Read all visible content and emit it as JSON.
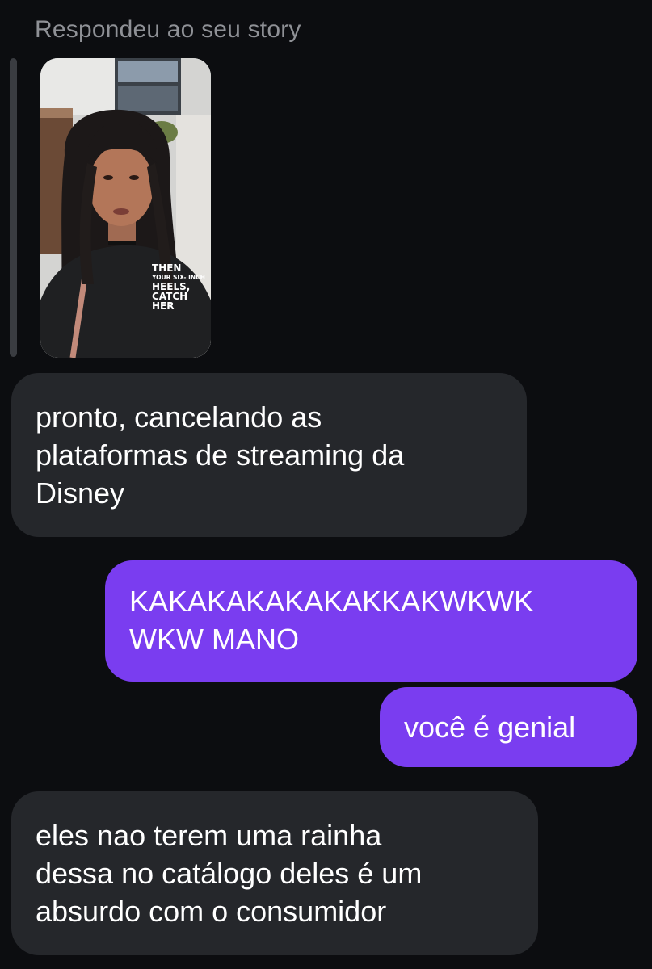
{
  "reply_label": "Respondeu ao seu story",
  "story": {
    "caption_line1": "THEN",
    "caption_line2": "YOUR SIX- INCH",
    "caption_line3": "HEELS,",
    "caption_line4": "CATCH",
    "caption_line5": "HER"
  },
  "messages": [
    {
      "direction": "incoming",
      "lines": [
        "pronto, cancelando as",
        "plataformas de streaming da",
        "Disney"
      ]
    },
    {
      "direction": "outgoing",
      "lines": [
        "KAKAKAKAKAKAKKAKWKWK",
        "WKW MANO"
      ]
    },
    {
      "direction": "outgoing",
      "lines": [
        "você é genial"
      ]
    },
    {
      "direction": "incoming",
      "lines": [
        "eles nao terem uma rainha",
        "dessa no catálogo deles é um",
        "absurdo com o consumidor"
      ]
    }
  ],
  "colors": {
    "background": "#0c0d10",
    "incoming_bubble": "#25272b",
    "outgoing_bubble": "#7a3df0",
    "muted_text": "#8f9196"
  }
}
